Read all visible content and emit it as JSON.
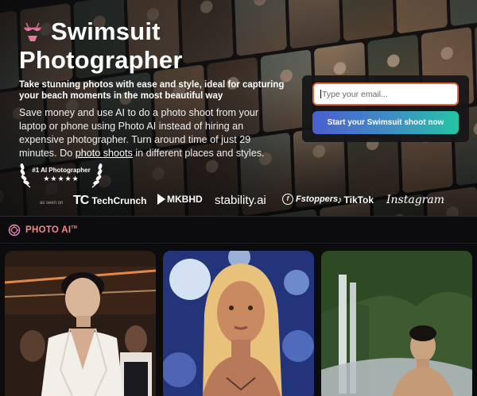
{
  "brand": {
    "icon": "bikini-icon",
    "title_line1": "Swimsuit",
    "title_line2": "Photographer"
  },
  "hero": {
    "tagline": "Take stunning photos with ease and style, ideal for capturing your beach moments in the most beautiful way",
    "desc_before_link": "Save money and use AI to do a photo shoot from your laptop or phone using Photo AI instead of hiring an expensive photographer. Turn around time of just 29 minutes. Do ",
    "desc_link": "photo shoots",
    "desc_after_link": " in different places and styles."
  },
  "award": {
    "label": "#1 AI Photographer",
    "stars": "★★★★★",
    "rating": 5
  },
  "press": {
    "as_seen_on": "as seen on",
    "techcrunch_mark": "TC",
    "techcrunch": "TechCrunch",
    "mkbhd": "MKBHD",
    "stability": "stability.ai",
    "fstoppers": "Fstoppers",
    "tiktok": "TikTok",
    "instagram": "Instagram"
  },
  "signup": {
    "email_placeholder": "Type your email...",
    "cta_label": "Start your Swimsuit shoot now"
  },
  "section": {
    "label": "PHOTO AI",
    "tm": "TM",
    "icon": "photo-ai-icon"
  },
  "colors": {
    "accent_orange": "#e0663b",
    "cta_start": "#4c5fd0",
    "cta_end": "#24c4a4",
    "section_label": "#f08a8a"
  }
}
